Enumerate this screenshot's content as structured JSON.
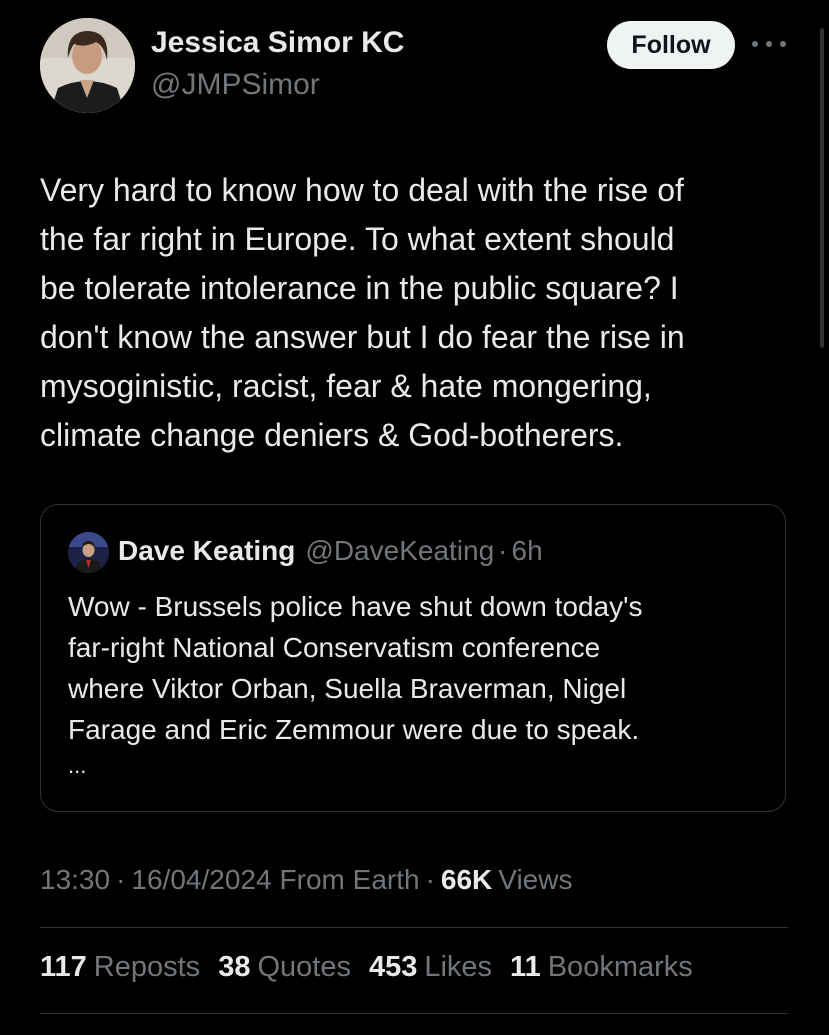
{
  "author": {
    "name": "Jessica Simor KC",
    "handle": "@JMPSimor",
    "follow_label": "Follow"
  },
  "tweet": {
    "text": "Very hard to know how to deal with the rise of\nthe far right in Europe.  To what extent should\nbe tolerate intolerance in the public square?  I\ndon't know the answer but I do fear the rise in\nmysoginistic, racist, fear & hate mongering,\nclimate change deniers & God-botherers."
  },
  "quoted_tweet": {
    "name": "Dave Keating",
    "handle": "@DaveKeating",
    "separator": "·",
    "time": "6h",
    "text": "Wow - Brussels police have shut down today's\nfar-right National Conservatism conference\nwhere Viktor Orban, Suella Braverman, Nigel\nFarage and Eric Zemmour were due to speak.",
    "ellipsis": "..."
  },
  "meta": {
    "time": "13:30",
    "separator": "·",
    "date": "16/04/2024",
    "source": "From Earth",
    "views_count": "66K",
    "views_label": "Views"
  },
  "stats": {
    "reposts_count": "117",
    "reposts_label": "Reposts",
    "quotes_count": "38",
    "quotes_label": "Quotes",
    "likes_count": "453",
    "likes_label": "Likes",
    "bookmarks_count": "11",
    "bookmarks_label": "Bookmarks"
  },
  "colors": {
    "background": "#000000",
    "primary_text": "#e7e9ea",
    "secondary_text": "#71767b",
    "border": "#2f3336",
    "follow_button_bg": "#eff3f4"
  }
}
